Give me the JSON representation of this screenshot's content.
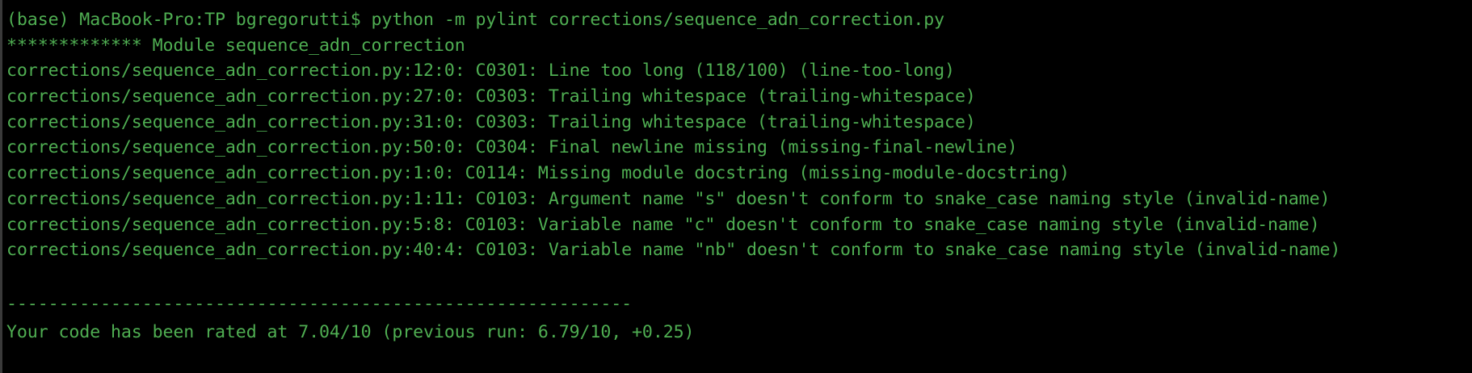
{
  "terminal": {
    "prompt": "(base) MacBook-Pro:TP bgregorutti$ python -m pylint corrections/sequence_adn_correction.py",
    "module_header": "************* Module sequence_adn_correction",
    "messages": [
      "corrections/sequence_adn_correction.py:12:0: C0301: Line too long (118/100) (line-too-long)",
      "corrections/sequence_adn_correction.py:27:0: C0303: Trailing whitespace (trailing-whitespace)",
      "corrections/sequence_adn_correction.py:31:0: C0303: Trailing whitespace (trailing-whitespace)",
      "corrections/sequence_adn_correction.py:50:0: C0304: Final newline missing (missing-final-newline)",
      "corrections/sequence_adn_correction.py:1:0: C0114: Missing module docstring (missing-module-docstring)",
      "corrections/sequence_adn_correction.py:1:11: C0103: Argument name \"s\" doesn't conform to snake_case naming style (invalid-name)",
      "corrections/sequence_adn_correction.py:5:8: C0103: Variable name \"c\" doesn't conform to snake_case naming style (invalid-name)",
      "corrections/sequence_adn_correction.py:40:4: C0103: Variable name \"nb\" doesn't conform to snake_case naming style (invalid-name)"
    ],
    "separator": "------------------------------------------------------------",
    "rating": "Your code has been rated at 7.04/10 (previous run: 6.79/10, +0.25)"
  },
  "colors": {
    "background": "#000000",
    "text": "#4fae52"
  }
}
